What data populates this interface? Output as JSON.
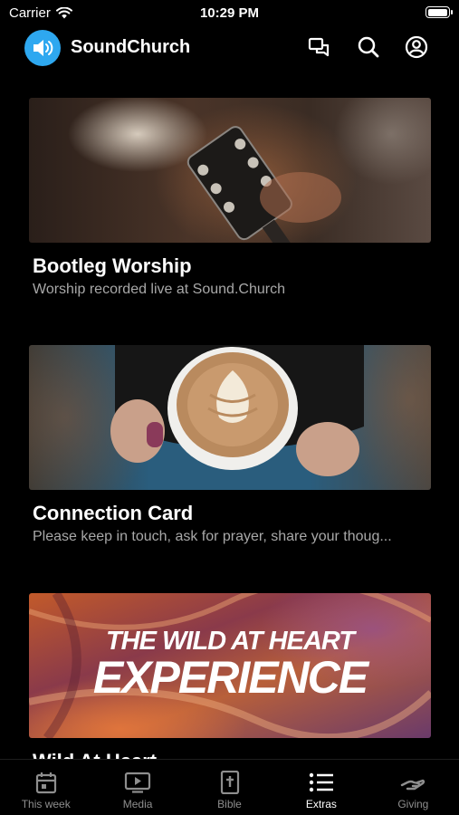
{
  "status_bar": {
    "carrier": "Carrier",
    "time": "10:29 PM"
  },
  "header": {
    "app_name": "SoundChurch"
  },
  "cards": [
    {
      "title": "Bootleg Worship",
      "subtitle": "Worship recorded live at Sound.Church"
    },
    {
      "title": "Connection Card",
      "subtitle": "Please keep in touch, ask for prayer, share your thoug..."
    },
    {
      "title": "Wild At Heart",
      "subtitle": "",
      "image_text": {
        "line1": "THE WILD AT HEART",
        "line2": "EXPERIENCE"
      }
    }
  ],
  "tabs": [
    {
      "label": "This week",
      "icon": "calendar-icon",
      "active": false
    },
    {
      "label": "Media",
      "icon": "tv-icon",
      "active": false
    },
    {
      "label": "Bible",
      "icon": "bible-icon",
      "active": false
    },
    {
      "label": "Extras",
      "icon": "list-icon",
      "active": true
    },
    {
      "label": "Giving",
      "icon": "giving-hand-icon",
      "active": false
    }
  ],
  "colors": {
    "accent": "#2ea8f0",
    "background": "#000000",
    "subtitle": "#a8a8a8",
    "tab_inactive": "#8e8e8e"
  }
}
